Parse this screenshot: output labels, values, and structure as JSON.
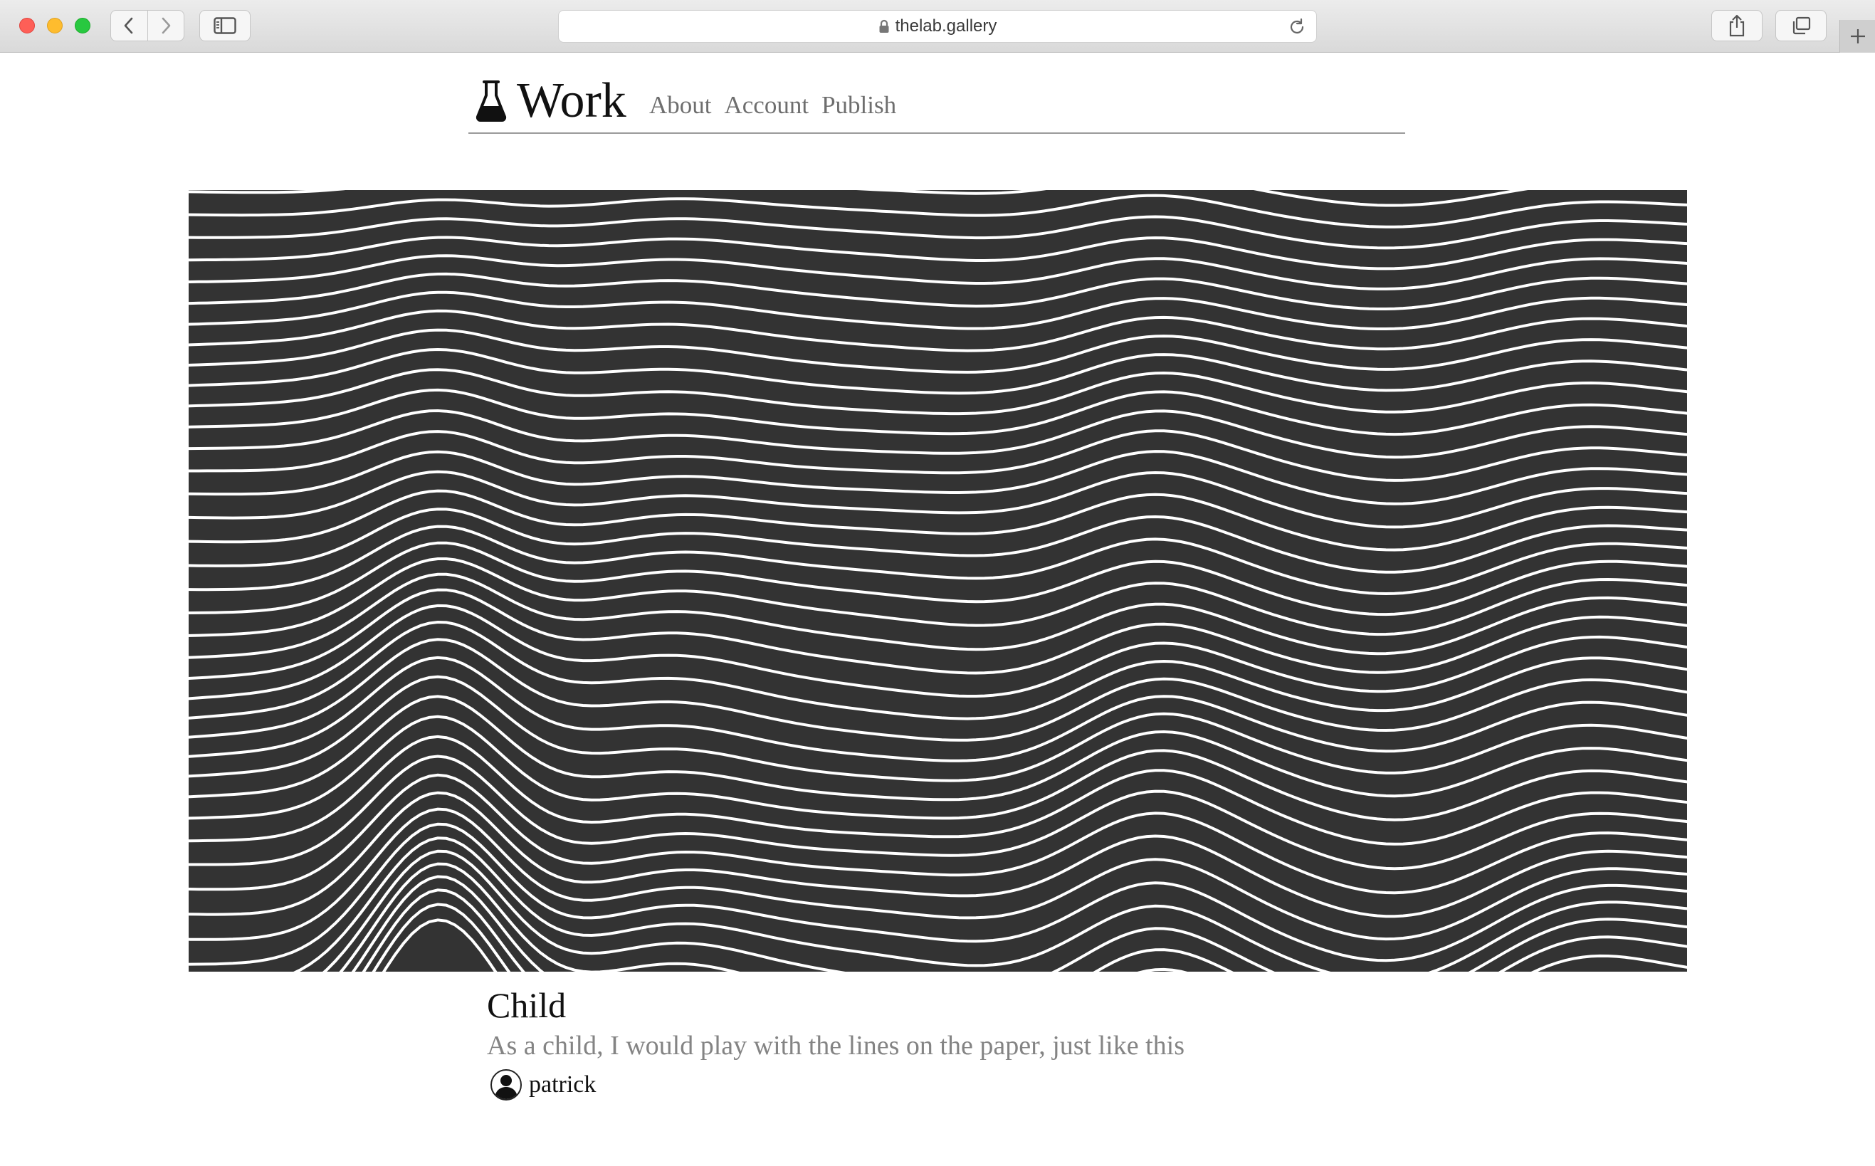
{
  "browser": {
    "url": "thelab.gallery",
    "icons": [
      "back-icon",
      "forward-icon",
      "sidebar-icon",
      "lock-icon",
      "reload-icon",
      "share-icon",
      "tabs-icon",
      "plus-icon"
    ]
  },
  "header": {
    "logo_icon": "flask-icon",
    "title": "Work",
    "nav": [
      {
        "label": "About"
      },
      {
        "label": "Account"
      },
      {
        "label": "Publish"
      }
    ]
  },
  "artwork": {
    "background_color": "#333333",
    "line_color": "#ffffff"
  },
  "work": {
    "title": "Child",
    "description": "As a child, I would play with the lines on the paper, just like this",
    "author": "patrick",
    "author_icon": "user-icon"
  }
}
